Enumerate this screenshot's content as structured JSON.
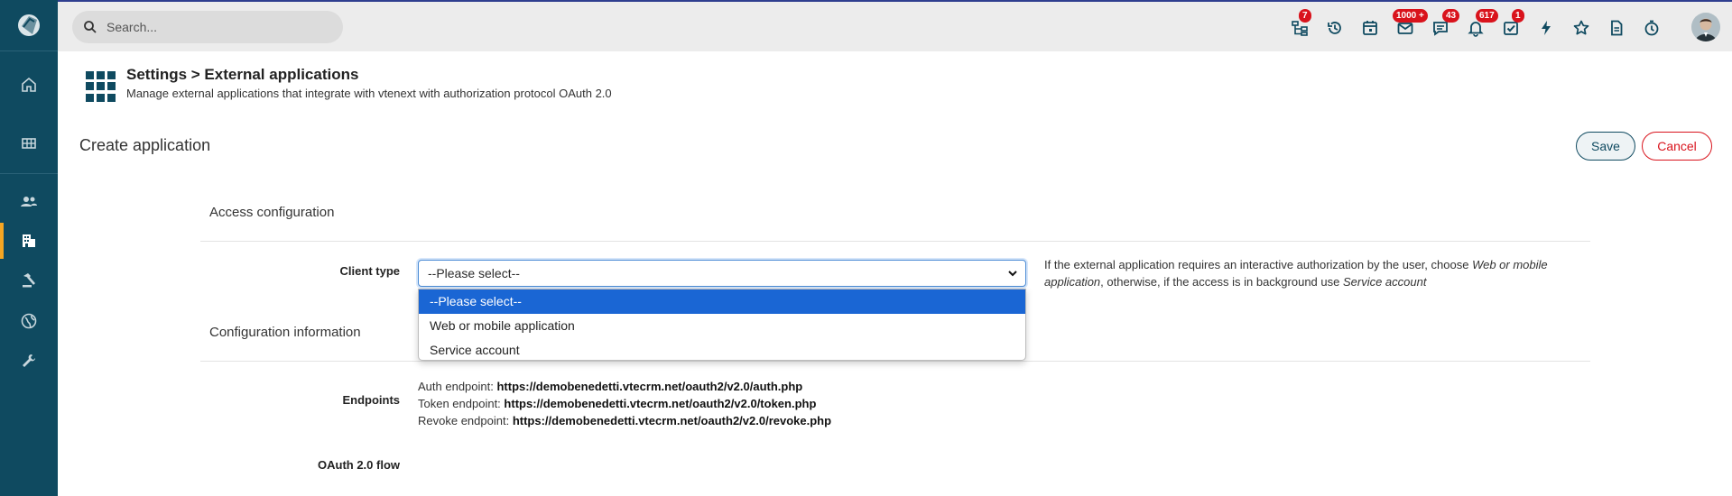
{
  "colors": {
    "sidebar_bg": "#0f4a60",
    "sidebar_active": "#f5a623",
    "topbar_bg": "#ececec",
    "badge": "#d9131c",
    "accent_blue": "#1a66d4",
    "cancel_red": "#d9131c"
  },
  "topbar": {
    "search_placeholder": "Search...",
    "icons": [
      {
        "name": "org-chart-icon",
        "badge": "7"
      },
      {
        "name": "history-icon",
        "badge": ""
      },
      {
        "name": "calendar-icon",
        "badge": ""
      },
      {
        "name": "mail-icon",
        "badge": "1000 +"
      },
      {
        "name": "chat-icon",
        "badge": "43"
      },
      {
        "name": "bell-icon",
        "badge": "617"
      },
      {
        "name": "task-check-icon",
        "badge": "1"
      },
      {
        "name": "lightning-icon",
        "badge": ""
      },
      {
        "name": "star-icon",
        "badge": ""
      },
      {
        "name": "document-icon",
        "badge": ""
      },
      {
        "name": "stopwatch-icon",
        "badge": ""
      }
    ]
  },
  "sidebar": {
    "items": [
      {
        "name": "home-icon"
      },
      {
        "name": "grid-icon"
      },
      {
        "name": "users-icon"
      },
      {
        "name": "building-icon",
        "active": true
      },
      {
        "name": "hammer-icon"
      },
      {
        "name": "globe-icon"
      },
      {
        "name": "wrench-icon"
      }
    ]
  },
  "header": {
    "breadcrumb": "Settings > External applications",
    "subtitle": "Manage external applications that integrate with vtenext with authorization protocol OAuth 2.0"
  },
  "page": {
    "title": "Create application",
    "save_label": "Save",
    "cancel_label": "Cancel"
  },
  "sections": {
    "access": "Access configuration",
    "config": "Configuration information"
  },
  "client_type": {
    "label": "Client type",
    "selected": "--Please select--",
    "options": [
      "--Please select--",
      "Web or mobile application",
      "Service account"
    ],
    "help_pre": "If the external application requires an interactive authorization by the user, choose ",
    "help_em1": "Web or mobile application",
    "help_mid": ", otherwise, if the access is in background use ",
    "help_em2": "Service account"
  },
  "endpoints": {
    "label": "Endpoints",
    "auth_label": "Auth endpoint:",
    "auth_url": "https://demobenedetti.vtecrm.net/oauth2/v2.0/auth.php",
    "token_label": "Token endpoint:",
    "token_url": "https://demobenedetti.vtecrm.net/oauth2/v2.0/token.php",
    "revoke_label": "Revoke endpoint:",
    "revoke_url": "https://demobenedetti.vtecrm.net/oauth2/v2.0/revoke.php"
  },
  "oauth_flow": {
    "label": "OAuth 2.0 flow"
  }
}
